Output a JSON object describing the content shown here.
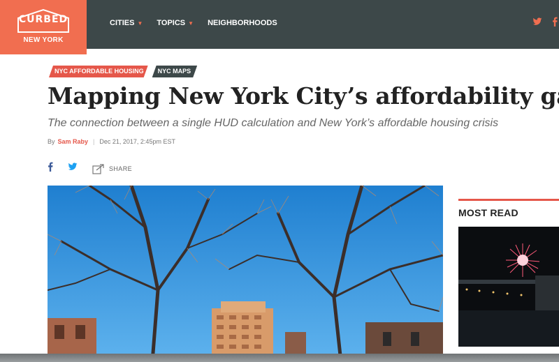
{
  "brand": {
    "wordmark": "CURBED",
    "city": "NEW YORK",
    "color": "#f16e50"
  },
  "nav": {
    "items": [
      {
        "label": "CITIES",
        "has_dropdown": true
      },
      {
        "label": "TOPICS",
        "has_dropdown": true
      },
      {
        "label": "NEIGHBORHOODS",
        "has_dropdown": false
      }
    ]
  },
  "social": [
    "twitter-icon",
    "facebook-icon"
  ],
  "article": {
    "tags": [
      "NYC AFFORDABLE HOUSING",
      "NYC MAPS"
    ],
    "headline": "Mapping New York City’s affordability gap",
    "dek": "The connection between a single HUD calculation and New York’s affordable housing crisis",
    "byline_prefix": "By",
    "author": "Sam Raby",
    "date": "Dec 21, 2017, 2:45pm EST",
    "share_label": "SHARE"
  },
  "sidebar": {
    "title": "MOST READ"
  },
  "colors": {
    "topbar": "#3d4849",
    "accent": "#e5574a",
    "sky": "#2e8fd9"
  }
}
